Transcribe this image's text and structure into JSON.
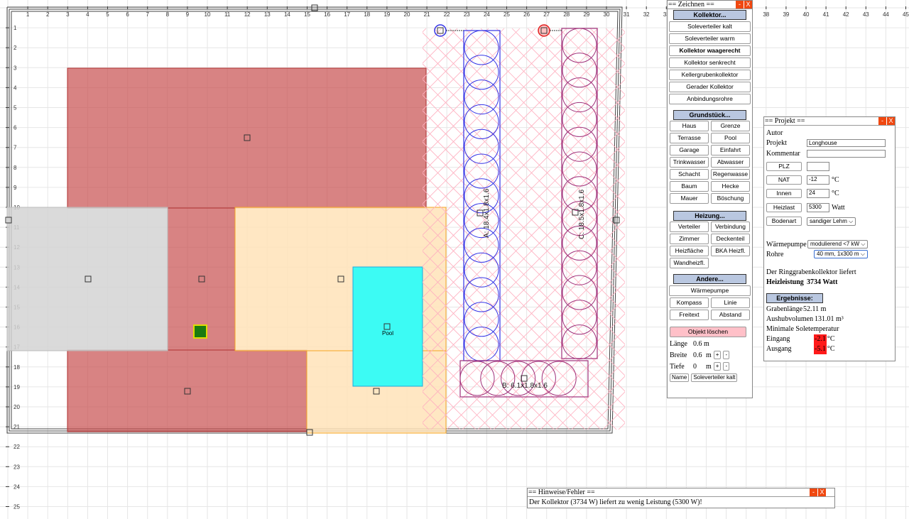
{
  "colors": {
    "house": "#c74e4e",
    "grey": "#d4d4d4",
    "terrace": "#ffe3b8",
    "pool": "#3cfbf4",
    "blue": "#3333e6",
    "magenta": "#a0307a",
    "pink": "#ffb0c0",
    "red": "#ff1a1a",
    "header": "#b9c7e0",
    "close": "#f04810"
  },
  "ruler": {
    "top": [
      "1",
      "2",
      "3",
      "4",
      "5",
      "6",
      "7",
      "8",
      "9",
      "10",
      "11",
      "12",
      "13",
      "14",
      "15",
      "16",
      "17",
      "18",
      "19",
      "20",
      "21",
      "22",
      "23",
      "24",
      "25",
      "26",
      "27",
      "28",
      "29",
      "30",
      "31",
      "32",
      "33",
      "38",
      "39",
      "40",
      "41",
      "42",
      "43",
      "44",
      "45"
    ],
    "left": [
      "1",
      "2",
      "3",
      "4",
      "5",
      "6",
      "7",
      "8",
      "9",
      "10",
      "11",
      "12",
      "13",
      "14",
      "15",
      "16",
      "17",
      "18",
      "19",
      "20",
      "21",
      "22",
      "23",
      "24",
      "25"
    ]
  },
  "plan": {
    "pool_label": "Pool",
    "collector_a": "A: 18.4x1.8x1.6",
    "collector_b": "B: 6.1x1.8x1.6",
    "collector_c": "C: 18.5x1.8x1.6"
  },
  "draw": {
    "title": "== Zeichnen ==",
    "minimize": "-",
    "close": "X",
    "sections": {
      "kollektor": "Kollektor...",
      "grund": "Grundstück...",
      "heizung": "Heizung...",
      "andere": "Andere..."
    },
    "kollektor": [
      "Soleverteiler kalt",
      "Soleverteiler warm",
      "Kollektor waagerecht",
      "Kollektor senkrecht",
      "Kellergrubenkollektor",
      "Gerader Kollektor",
      "Anbindungsrohre"
    ],
    "grund": [
      "Haus",
      "Grenze",
      "Terrasse",
      "Pool",
      "Garage",
      "Einfahrt",
      "Trinkwasser",
      "Abwasser",
      "Schacht",
      "Regenwasse",
      "Baum",
      "Hecke",
      "Mauer",
      "Böschung"
    ],
    "heizung": [
      "Verteiler",
      "Verbindung",
      "Zimmer",
      "Deckenteil",
      "Heizfläche",
      "BKA Heizfl.",
      "Wandheizfl."
    ],
    "andere": {
      "waermepumpe": "Wärmepumpe",
      "kompass": "Kompass",
      "linie": "Linie",
      "freitext": "Freitext",
      "abstand": "Abstand"
    },
    "delete": "Objekt löschen",
    "laenge": {
      "label": "Länge",
      "value": "0.6 m"
    },
    "breite": {
      "label": "Breite",
      "value": "0.6",
      "unit": "m"
    },
    "tiefe": {
      "label": "Tiefe",
      "value": "0",
      "unit": "m"
    },
    "plus": "+",
    "minus": "-",
    "name_btn": "Name",
    "name_value": "Soleverteiler kalt"
  },
  "project": {
    "title": "== Projekt ==",
    "minimize": "-",
    "close": "X",
    "autor": "Autor",
    "projekt_label": "Projekt",
    "projekt_value": "Longhouse",
    "kommentar_label": "Kommentar",
    "kommentar_value": "",
    "plz_btn": "PLZ",
    "plz_value": "",
    "nat_btn": "NAT",
    "nat_value": "-12",
    "nat_unit": "°C",
    "innen_btn": "Innen",
    "innen_value": "24",
    "innen_unit": "°C",
    "heizlast_btn": "Heizlast",
    "heizlast_value": "5300",
    "heizlast_unit": "Watt",
    "bodenart_btn": "Bodenart",
    "bodenart_value": "sandiger Lehm",
    "waermepumpe_label": "Wärmepumpe",
    "waermepumpe_value": "modulierend <7 kW",
    "rohre_label": "Rohre",
    "rohre_value": "40 mm, 1x300 m",
    "liefert": "Der Ringgrabenkollektor liefert",
    "heizleistung_label": "Heizleistung",
    "heizleistung_value": "3734 Watt",
    "ergebnisse": "Ergebnisse:",
    "grabenlaenge_label": "Grabenlänge",
    "grabenlaenge_value": "52.11 m",
    "aushub_label": "Aushubvolumen",
    "aushub_value": "131.01 m³",
    "minsole": "Minimale Soletemperatur",
    "eingang_label": "Eingang",
    "eingang_value": "-2.1",
    "eingang_unit": "°C",
    "ausgang_label": "Ausgang",
    "ausgang_value": "-5.1",
    "ausgang_unit": "°C"
  },
  "hints": {
    "title": "== Hinweise/Fehler ==",
    "minimize": "-",
    "close": "X",
    "message": "Der Kollektor (3734 W) liefert zu wenig Leistung (5300 W)!"
  }
}
